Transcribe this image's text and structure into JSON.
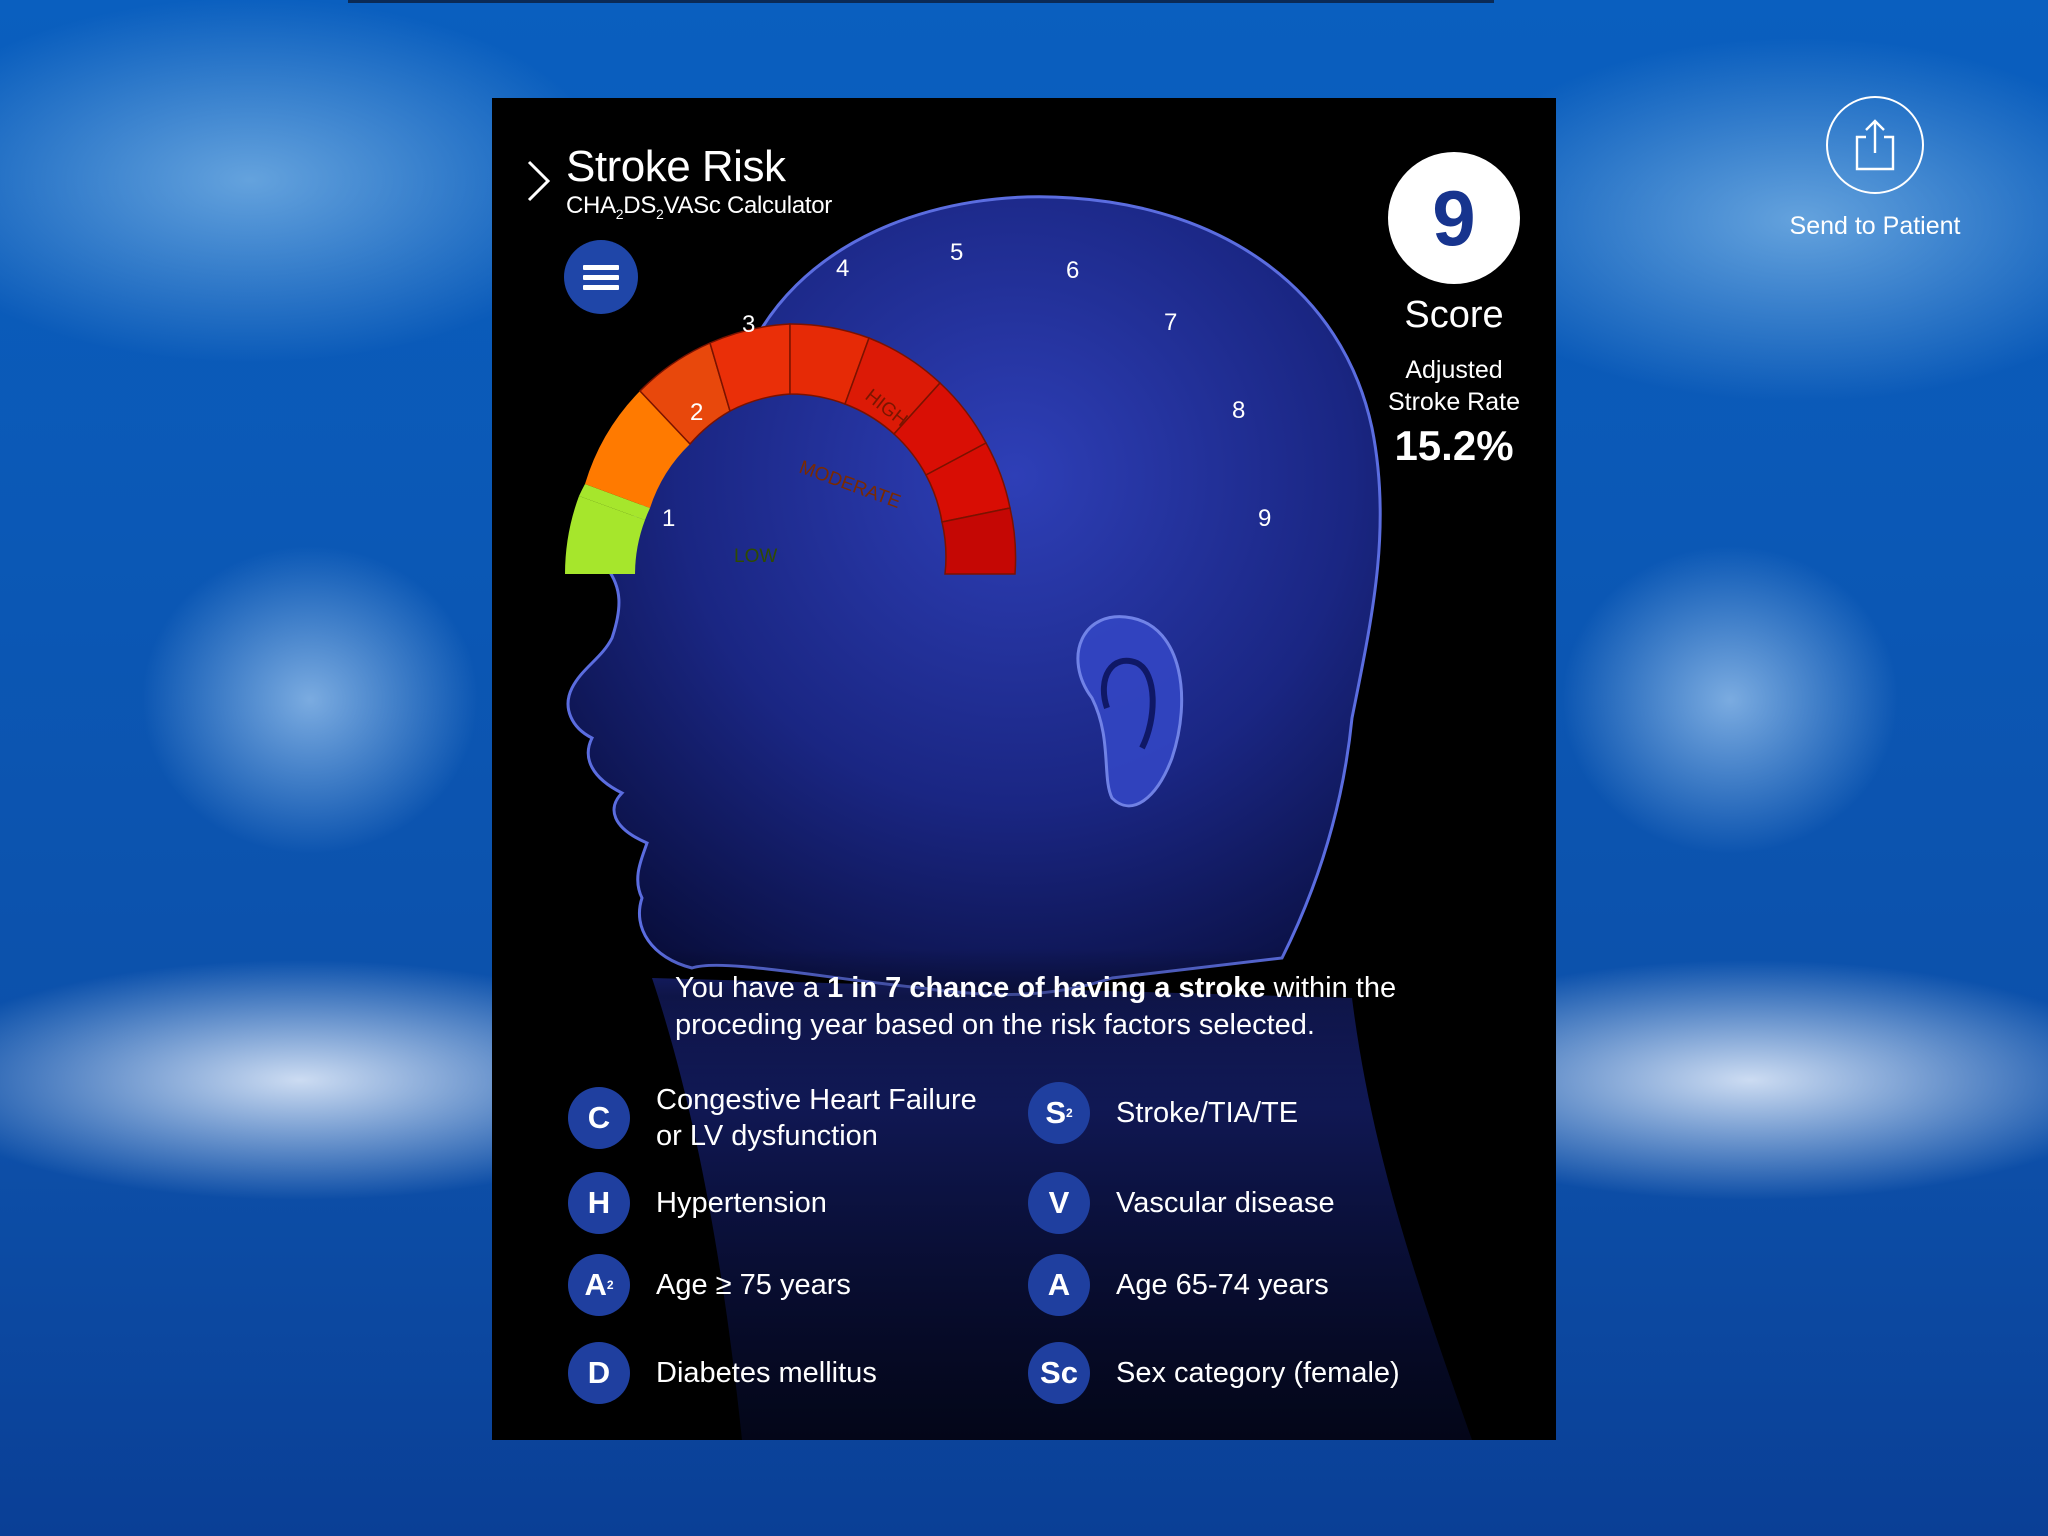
{
  "send_to_patient": {
    "label": "Send to Patient",
    "icon": "share-icon"
  },
  "header": {
    "title": "Stroke Risk",
    "subtitle_parts": [
      "CHA",
      "2",
      "DS",
      "2",
      "VASc Calculator"
    ]
  },
  "gauge": {
    "ticks": [
      "1",
      "2",
      "3",
      "4",
      "5",
      "6",
      "7",
      "8",
      "9"
    ],
    "band_labels": {
      "low": "LOW",
      "moderate": "MODERATE",
      "high": "HIGH"
    },
    "score_value": 9,
    "colors": {
      "low": "#a6e62c",
      "moderate": "#ff7a00",
      "high_segments": [
        "#e8480c",
        "#ea2f08",
        "#e62a06",
        "#dc1a06",
        "#d90f05",
        "#d80d04",
        "#cf0a04",
        "#c50704"
      ]
    }
  },
  "score": {
    "value": "9",
    "label": "Score",
    "adjusted_label_line1": "Adjusted",
    "adjusted_label_line2": "Stroke Rate",
    "rate": "15.2%"
  },
  "message": {
    "prefix": "You have a ",
    "bold": "1 in 7 chance of having a stroke",
    "suffix": " within the proceding year based on the risk factors selected."
  },
  "factors": [
    {
      "letter": "C",
      "sub": "",
      "text": "Congestive Heart Failure or LV dysfunction"
    },
    {
      "letter": "S",
      "sub": "2",
      "text": "Stroke/TIA/TE"
    },
    {
      "letter": "H",
      "sub": "",
      "text": "Hypertension"
    },
    {
      "letter": "V",
      "sub": "",
      "text": "Vascular disease"
    },
    {
      "letter": "A",
      "sub": "2",
      "text": "Age ≥ 75 years"
    },
    {
      "letter": "A",
      "sub": "",
      "text": "Age 65-74 years"
    },
    {
      "letter": "D",
      "sub": "",
      "text": "Diabetes mellitus"
    },
    {
      "letter": "Sc",
      "sub": "",
      "text": "Sex category (female)"
    }
  ],
  "colors": {
    "badge": "#1f3f9f",
    "score_text": "#17348e",
    "background": "#0b57b4"
  }
}
